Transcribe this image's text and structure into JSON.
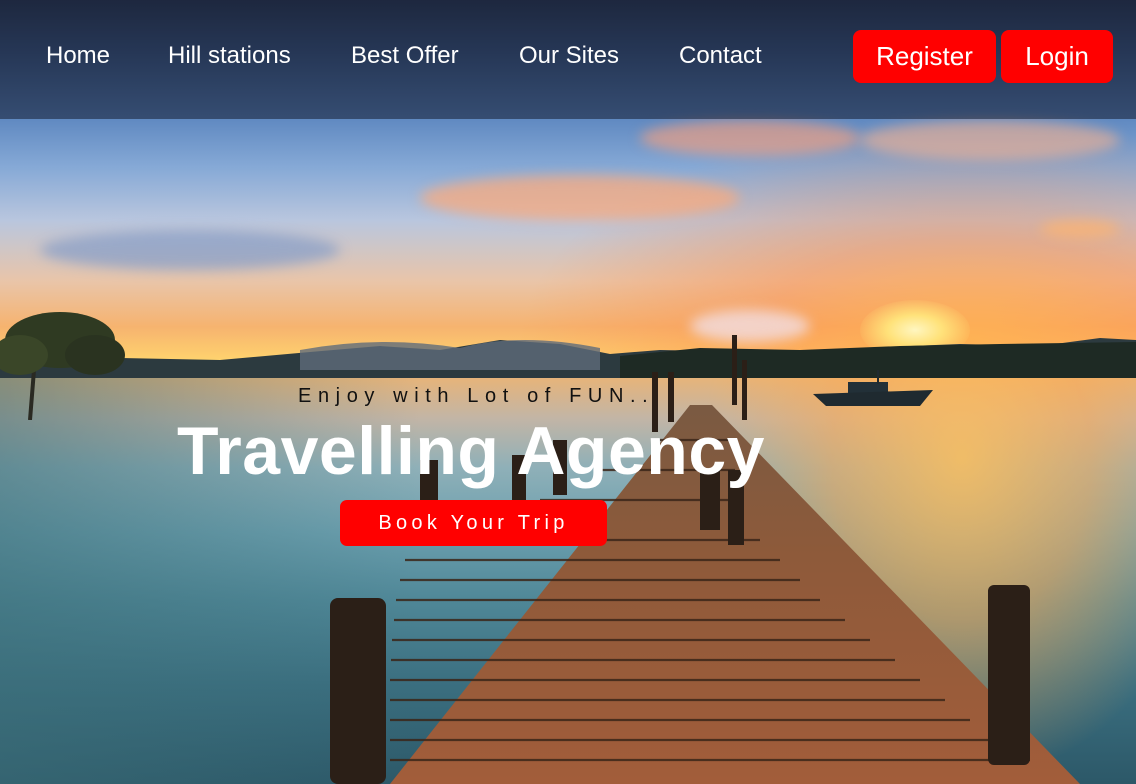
{
  "nav": {
    "items": [
      {
        "label": "Home"
      },
      {
        "label": "Hill stations"
      },
      {
        "label": "Best Offer"
      },
      {
        "label": "Our Sites"
      },
      {
        "label": "Contact"
      }
    ],
    "register_label": "Register",
    "login_label": "Login"
  },
  "hero": {
    "tagline": "Enjoy with Lot of FUN..",
    "title": "Travelling Agency",
    "cta_label": "Book Your Trip",
    "background_image": "lake-sunset-wooden-pier"
  },
  "colors": {
    "accent": "#ff0000",
    "nav_text": "#ffffff",
    "tagline_text": "#111111",
    "title_text": "#ffffff",
    "topbar_overlay": "rgba(20, 28, 48, 0.55)"
  }
}
